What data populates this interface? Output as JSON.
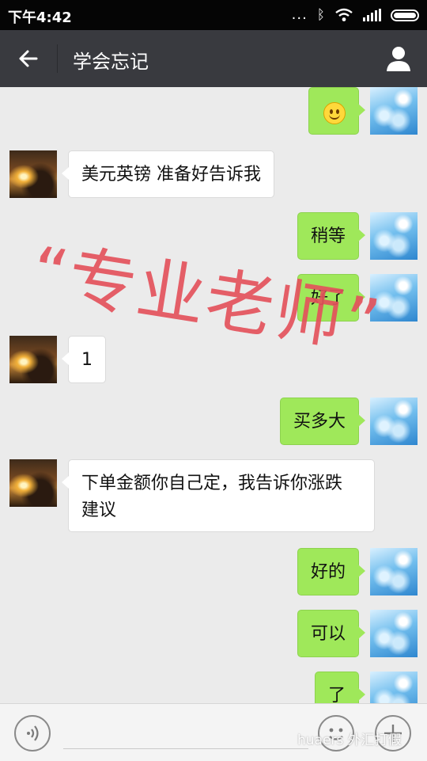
{
  "status_bar": {
    "time": "下午4:42",
    "dots": "..."
  },
  "header": {
    "title": "学会忘记"
  },
  "messages": [
    {
      "side": "right",
      "type": "emoji",
      "emoji": "smile"
    },
    {
      "side": "left",
      "text": "美元英镑 准备好告诉我"
    },
    {
      "side": "right",
      "text": "稍等"
    },
    {
      "side": "right",
      "text": "好了"
    },
    {
      "side": "left",
      "text": "1"
    },
    {
      "side": "right",
      "text": "买多大"
    },
    {
      "side": "left",
      "line1": "下单金额你自己定，我告诉你涨跌",
      "line2": "建议"
    },
    {
      "side": "right",
      "text": "好的"
    },
    {
      "side": "right",
      "text": "可以"
    },
    {
      "side": "right",
      "text": "了"
    }
  ],
  "overlay": {
    "text": "“专业老师”"
  },
  "source_mark": "huaers 外汇打假",
  "colors": {
    "bubble_right": "#9fe85a",
    "bubble_left": "#ffffff",
    "title_bar": "#393a3f",
    "overlay": "#e4535c"
  }
}
